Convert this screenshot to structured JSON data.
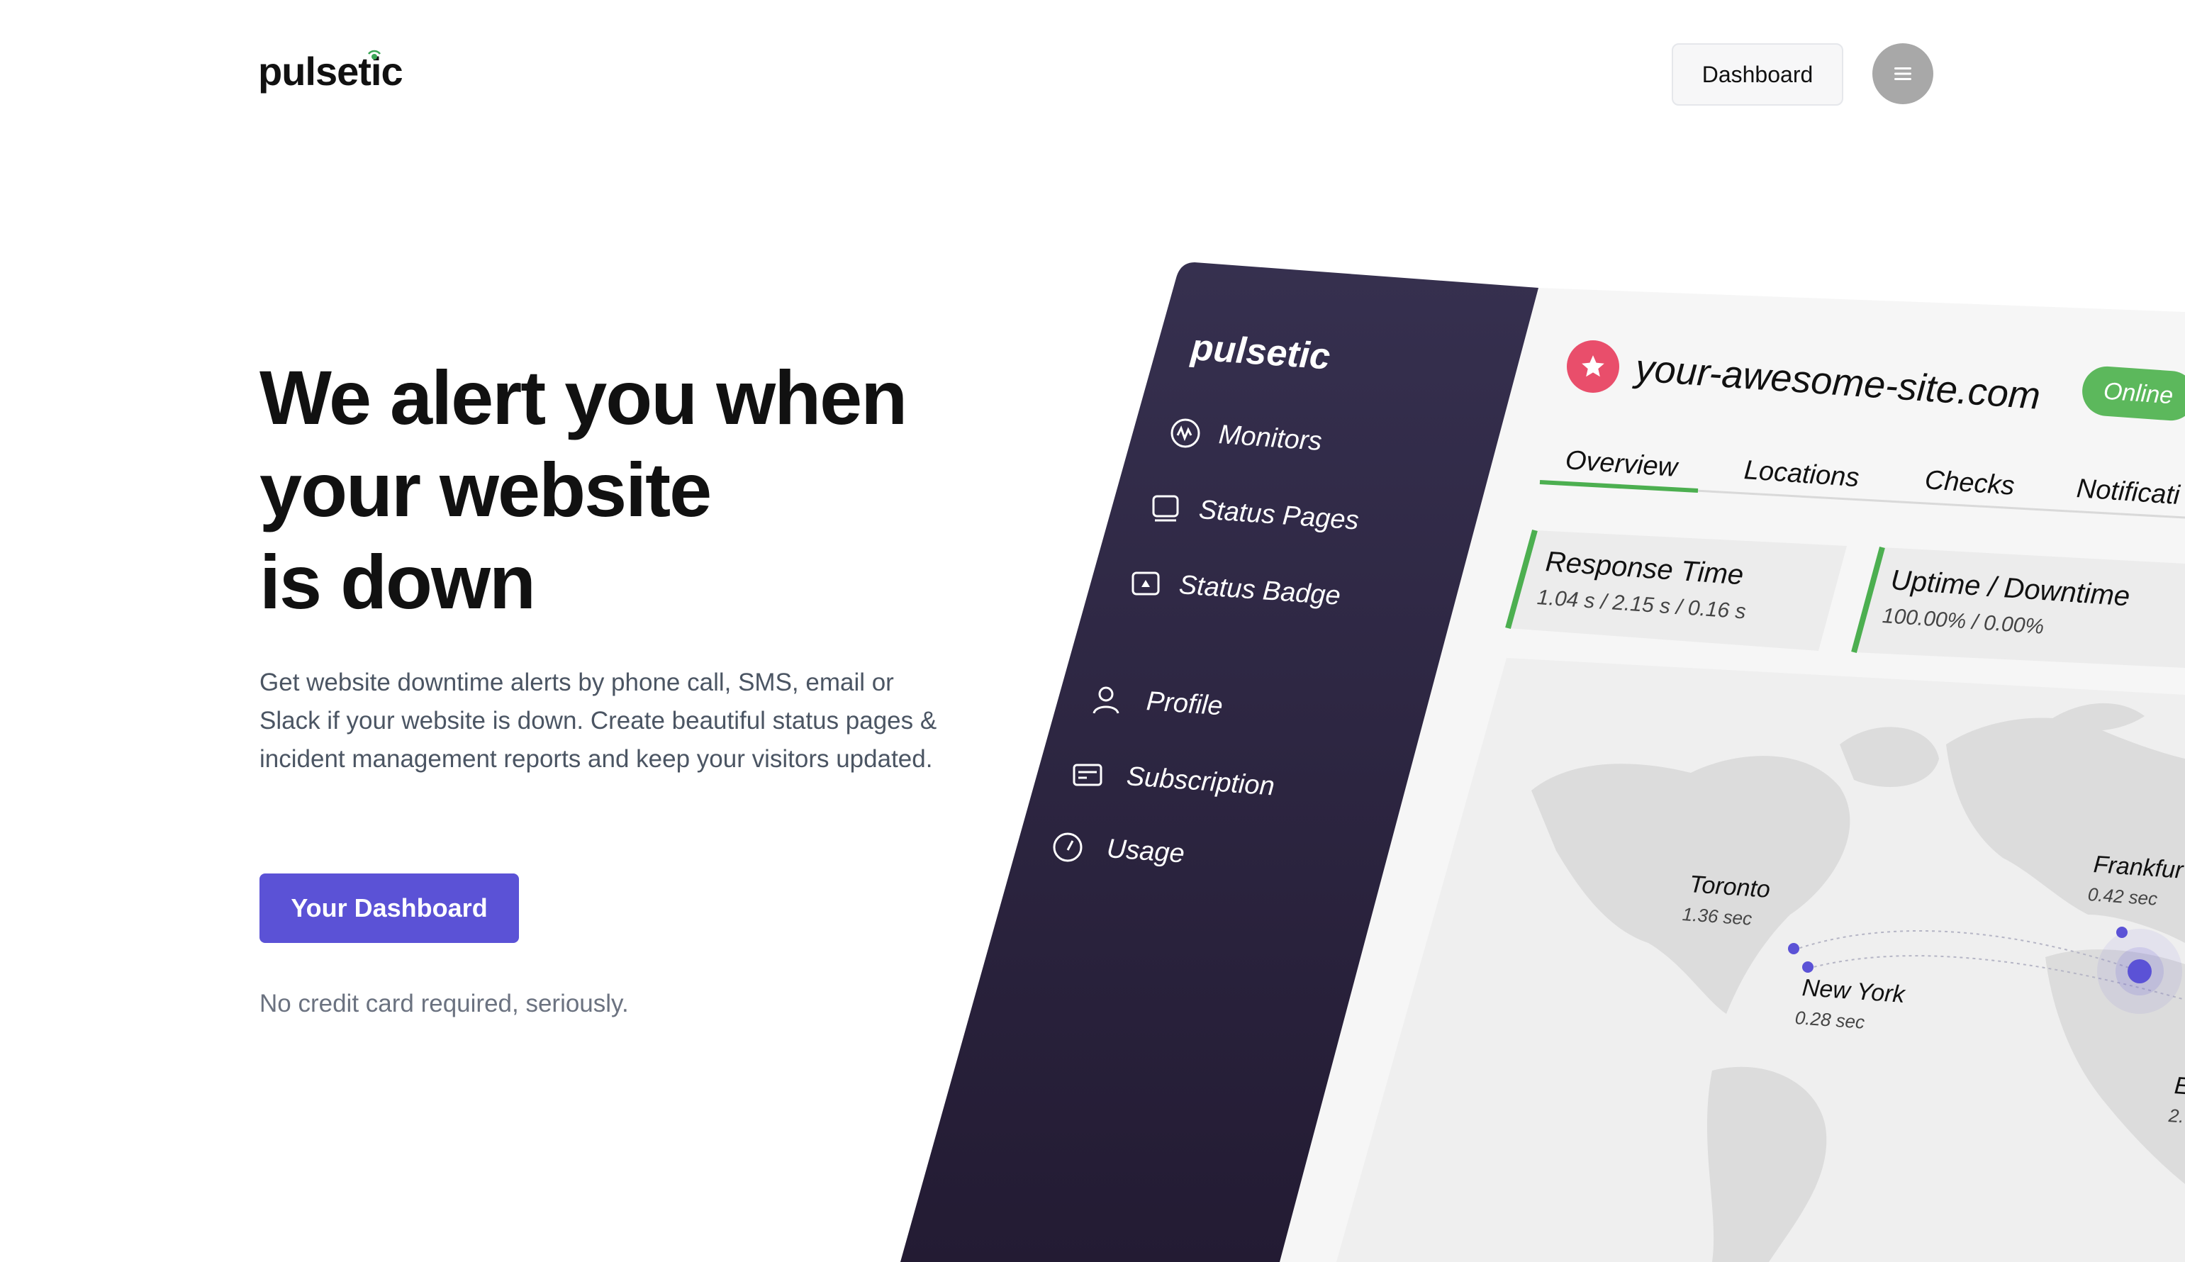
{
  "brand": {
    "name": "pulsetic"
  },
  "nav": {
    "dashboard_label": "Dashboard",
    "menu_icon": "menu-icon"
  },
  "hero": {
    "headline_line1": "We alert you when",
    "headline_line2": "your website",
    "headline_line3": "is down",
    "subtext": "Get website downtime alerts by phone call, SMS, email or Slack if your website is down. Create beautiful status pages & incident management reports and keep your visitors updated.",
    "cta_label": "Your Dashboard",
    "fine_print": "No credit card required, seriously."
  },
  "mockup": {
    "brand": "pulsetic",
    "sidebar": [
      {
        "label": "Monitors",
        "icon": "monitor-pulse-icon"
      },
      {
        "label": "Status Pages",
        "icon": "status-page-icon"
      },
      {
        "label": "Status Badge",
        "icon": "badge-icon"
      },
      {
        "label": "Profile",
        "icon": "user-icon"
      },
      {
        "label": "Subscription",
        "icon": "card-icon"
      },
      {
        "label": "Usage",
        "icon": "gauge-icon"
      }
    ],
    "site": {
      "domain": "your-awesome-site.com",
      "status": "Online"
    },
    "tabs": [
      "Overview",
      "Locations",
      "Checks",
      "Notificati"
    ],
    "cards": [
      {
        "title": "Response Time",
        "value": "1.04 s / 2.15 s / 0.16 s"
      },
      {
        "title": "Uptime / Downtime",
        "value": "100.00% / 0.00%"
      }
    ],
    "cities": [
      {
        "name": "Toronto",
        "time": "1.36 sec"
      },
      {
        "name": "New York",
        "time": "0.28 sec"
      },
      {
        "name": "Frankfur",
        "time": "0.42 sec"
      },
      {
        "name": "E",
        "time": "2."
      }
    ]
  },
  "colors": {
    "accent": "#5b52d6",
    "sidebar": "#2a2140",
    "online": "#5cb85c",
    "star": "#e94e6b"
  }
}
